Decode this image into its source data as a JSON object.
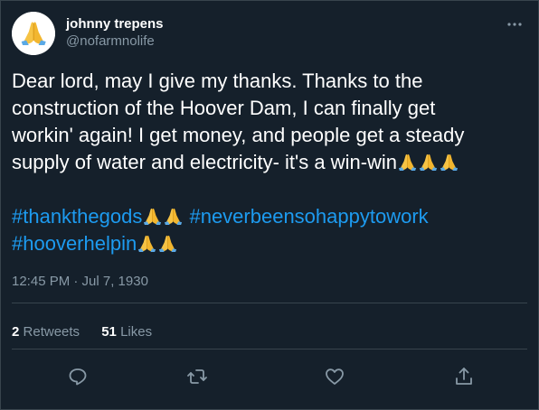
{
  "user": {
    "display_name": "johnny trepens",
    "handle": "@nofarmnolife",
    "avatar_icon": "folded-hands-emoji"
  },
  "tweet": {
    "lines": [
      "Dear lord, may I give my thanks. Thanks to the",
      "construction of the Hoover Dam, I can finally get",
      "workin' again! I get money, and people get a steady",
      "supply of water and electricity- it's a win-win"
    ],
    "hashtags": [
      "#thankthegods",
      "#neverbeensohappytowork",
      "#hooverhelpin"
    ],
    "emoji": "folded-hands-emoji"
  },
  "timestamp": "12:45 PM · Jul 7, 1930",
  "stats": {
    "retweets_count": "2",
    "retweets_label": "Retweets",
    "likes_count": "51",
    "likes_label": "Likes"
  },
  "colors": {
    "background": "#15202b",
    "border": "#38444d",
    "secondary_text": "#8899a6",
    "hashtag": "#1d9bf0"
  },
  "icons": [
    "more-icon",
    "reply-icon",
    "retweet-icon",
    "like-icon",
    "share-icon"
  ]
}
